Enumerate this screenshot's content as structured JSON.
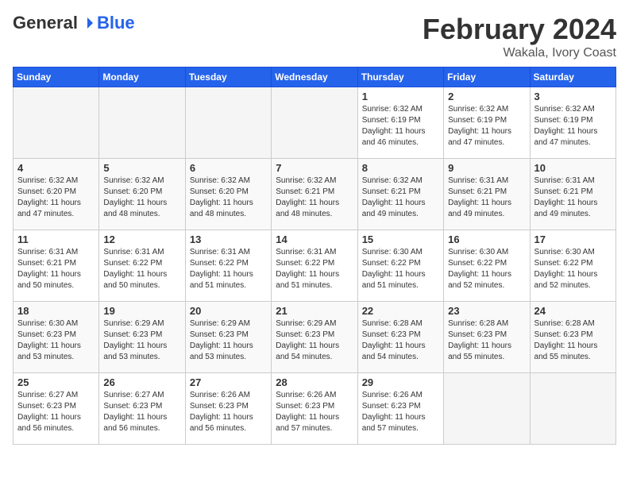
{
  "logo": {
    "general": "General",
    "blue": "Blue"
  },
  "title": "February 2024",
  "location": "Wakala, Ivory Coast",
  "days_of_week": [
    "Sunday",
    "Monday",
    "Tuesday",
    "Wednesday",
    "Thursday",
    "Friday",
    "Saturday"
  ],
  "weeks": [
    [
      {
        "day": "",
        "info": ""
      },
      {
        "day": "",
        "info": ""
      },
      {
        "day": "",
        "info": ""
      },
      {
        "day": "",
        "info": ""
      },
      {
        "day": "1",
        "info": "Sunrise: 6:32 AM\nSunset: 6:19 PM\nDaylight: 11 hours\nand 46 minutes."
      },
      {
        "day": "2",
        "info": "Sunrise: 6:32 AM\nSunset: 6:19 PM\nDaylight: 11 hours\nand 47 minutes."
      },
      {
        "day": "3",
        "info": "Sunrise: 6:32 AM\nSunset: 6:19 PM\nDaylight: 11 hours\nand 47 minutes."
      }
    ],
    [
      {
        "day": "4",
        "info": "Sunrise: 6:32 AM\nSunset: 6:20 PM\nDaylight: 11 hours\nand 47 minutes."
      },
      {
        "day": "5",
        "info": "Sunrise: 6:32 AM\nSunset: 6:20 PM\nDaylight: 11 hours\nand 48 minutes."
      },
      {
        "day": "6",
        "info": "Sunrise: 6:32 AM\nSunset: 6:20 PM\nDaylight: 11 hours\nand 48 minutes."
      },
      {
        "day": "7",
        "info": "Sunrise: 6:32 AM\nSunset: 6:21 PM\nDaylight: 11 hours\nand 48 minutes."
      },
      {
        "day": "8",
        "info": "Sunrise: 6:32 AM\nSunset: 6:21 PM\nDaylight: 11 hours\nand 49 minutes."
      },
      {
        "day": "9",
        "info": "Sunrise: 6:31 AM\nSunset: 6:21 PM\nDaylight: 11 hours\nand 49 minutes."
      },
      {
        "day": "10",
        "info": "Sunrise: 6:31 AM\nSunset: 6:21 PM\nDaylight: 11 hours\nand 49 minutes."
      }
    ],
    [
      {
        "day": "11",
        "info": "Sunrise: 6:31 AM\nSunset: 6:21 PM\nDaylight: 11 hours\nand 50 minutes."
      },
      {
        "day": "12",
        "info": "Sunrise: 6:31 AM\nSunset: 6:22 PM\nDaylight: 11 hours\nand 50 minutes."
      },
      {
        "day": "13",
        "info": "Sunrise: 6:31 AM\nSunset: 6:22 PM\nDaylight: 11 hours\nand 51 minutes."
      },
      {
        "day": "14",
        "info": "Sunrise: 6:31 AM\nSunset: 6:22 PM\nDaylight: 11 hours\nand 51 minutes."
      },
      {
        "day": "15",
        "info": "Sunrise: 6:30 AM\nSunset: 6:22 PM\nDaylight: 11 hours\nand 51 minutes."
      },
      {
        "day": "16",
        "info": "Sunrise: 6:30 AM\nSunset: 6:22 PM\nDaylight: 11 hours\nand 52 minutes."
      },
      {
        "day": "17",
        "info": "Sunrise: 6:30 AM\nSunset: 6:22 PM\nDaylight: 11 hours\nand 52 minutes."
      }
    ],
    [
      {
        "day": "18",
        "info": "Sunrise: 6:30 AM\nSunset: 6:23 PM\nDaylight: 11 hours\nand 53 minutes."
      },
      {
        "day": "19",
        "info": "Sunrise: 6:29 AM\nSunset: 6:23 PM\nDaylight: 11 hours\nand 53 minutes."
      },
      {
        "day": "20",
        "info": "Sunrise: 6:29 AM\nSunset: 6:23 PM\nDaylight: 11 hours\nand 53 minutes."
      },
      {
        "day": "21",
        "info": "Sunrise: 6:29 AM\nSunset: 6:23 PM\nDaylight: 11 hours\nand 54 minutes."
      },
      {
        "day": "22",
        "info": "Sunrise: 6:28 AM\nSunset: 6:23 PM\nDaylight: 11 hours\nand 54 minutes."
      },
      {
        "day": "23",
        "info": "Sunrise: 6:28 AM\nSunset: 6:23 PM\nDaylight: 11 hours\nand 55 minutes."
      },
      {
        "day": "24",
        "info": "Sunrise: 6:28 AM\nSunset: 6:23 PM\nDaylight: 11 hours\nand 55 minutes."
      }
    ],
    [
      {
        "day": "25",
        "info": "Sunrise: 6:27 AM\nSunset: 6:23 PM\nDaylight: 11 hours\nand 56 minutes."
      },
      {
        "day": "26",
        "info": "Sunrise: 6:27 AM\nSunset: 6:23 PM\nDaylight: 11 hours\nand 56 minutes."
      },
      {
        "day": "27",
        "info": "Sunrise: 6:26 AM\nSunset: 6:23 PM\nDaylight: 11 hours\nand 56 minutes."
      },
      {
        "day": "28",
        "info": "Sunrise: 6:26 AM\nSunset: 6:23 PM\nDaylight: 11 hours\nand 57 minutes."
      },
      {
        "day": "29",
        "info": "Sunrise: 6:26 AM\nSunset: 6:23 PM\nDaylight: 11 hours\nand 57 minutes."
      },
      {
        "day": "",
        "info": ""
      },
      {
        "day": "",
        "info": ""
      }
    ]
  ]
}
